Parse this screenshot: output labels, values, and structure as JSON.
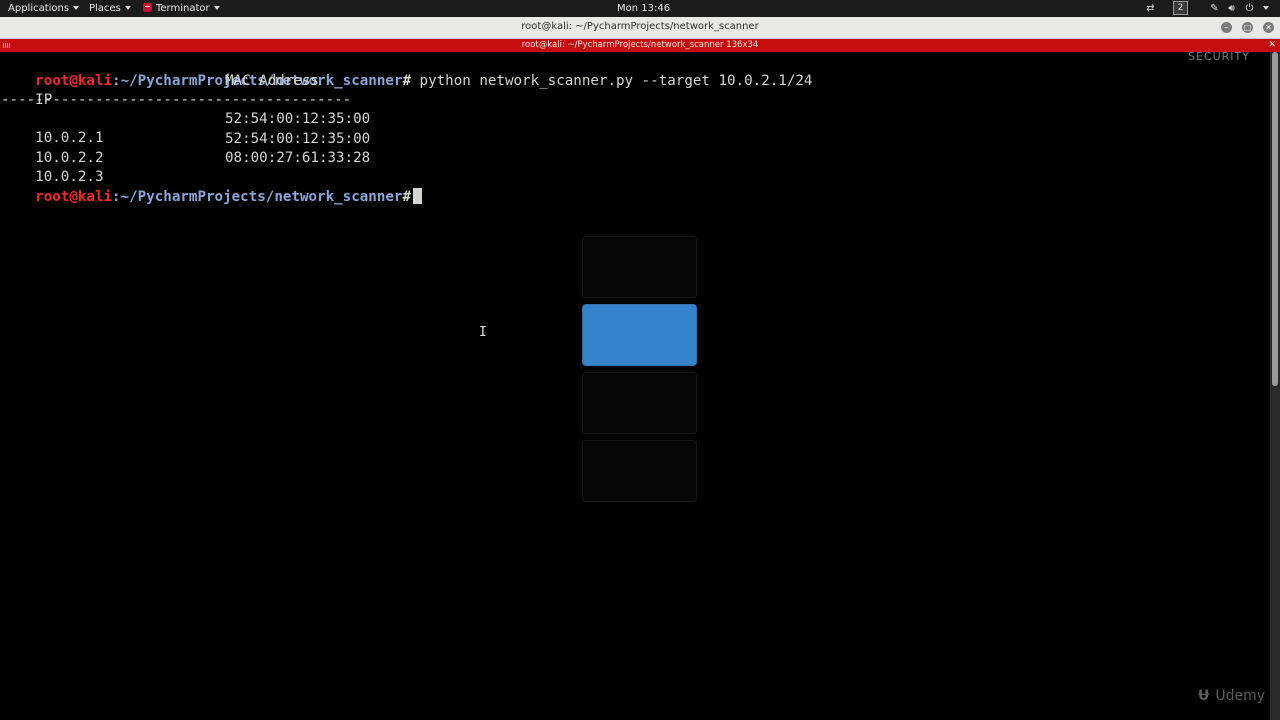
{
  "topbar": {
    "applications": "Applications",
    "places": "Places",
    "terminator": "Terminator",
    "clock": "Mon 13:46",
    "workspace_number": "2"
  },
  "window": {
    "title": "root@kali: ~/PycharmProjects/network_scanner",
    "terminator_header": "root@kali: ~/PycharmProjects/network_scanner 136x34"
  },
  "terminal": {
    "prompt_user": "root@kali",
    "prompt_path": ":~/PycharmProjects/network_scanner",
    "prompt_hash": "#",
    "command": " python network_scanner.py --target 10.0.2.1/24",
    "header_ip": "IP",
    "header_mac": "MAC Address",
    "separator": "-----------------------------------------",
    "rows": [
      {
        "ip": "10.0.2.1",
        "mac": "52:54:00:12:35:00"
      },
      {
        "ip": "10.0.2.2",
        "mac": "52:54:00:12:35:00"
      },
      {
        "ip": "10.0.2.3",
        "mac": "08:00:27:61:33:28"
      }
    ]
  },
  "watermarks": {
    "security": "SECURITY",
    "udemy": "Udemy"
  },
  "colors": {
    "prompt_user": "#ef2929",
    "prompt_path": "#8aa5d6",
    "terminator_header": "#c50d0d",
    "workspace_active": "#3583cb"
  }
}
